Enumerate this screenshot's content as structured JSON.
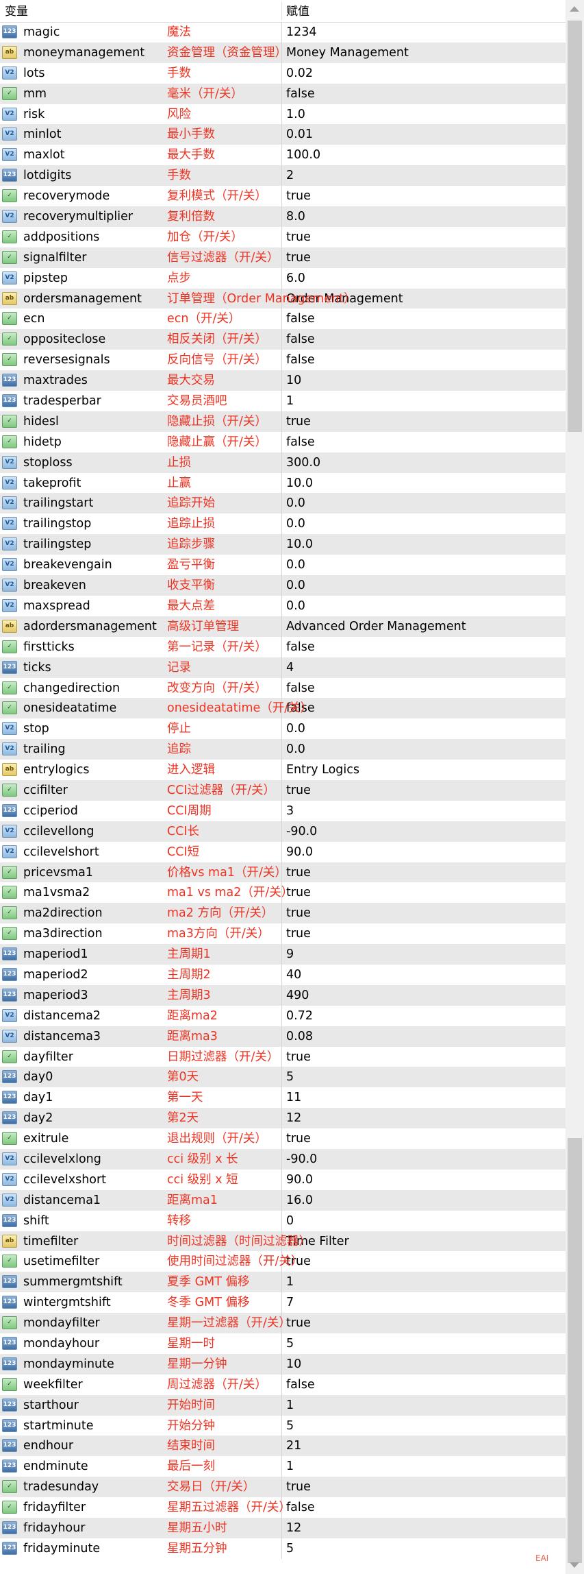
{
  "header": {
    "col_var": "变量",
    "col_val": "赋值"
  },
  "watermark": "EAI",
  "rows": [
    {
      "type": "int",
      "name": "magic",
      "zh": "魔法",
      "value": "1234"
    },
    {
      "type": "str",
      "name": "moneymanagement",
      "zh": "资金管理（资金管理）",
      "value": "Money Management"
    },
    {
      "type": "dbl",
      "name": "lots",
      "zh": "手数",
      "value": "0.02"
    },
    {
      "type": "bool",
      "name": "mm",
      "zh": "毫米（开/关）",
      "value": "false"
    },
    {
      "type": "dbl",
      "name": "risk",
      "zh": "风险",
      "value": "1.0"
    },
    {
      "type": "dbl",
      "name": "minlot",
      "zh": "最小手数",
      "value": "0.01"
    },
    {
      "type": "dbl",
      "name": "maxlot",
      "zh": "最大手数",
      "value": "100.0"
    },
    {
      "type": "int",
      "name": "lotdigits",
      "zh": "手数",
      "value": "2"
    },
    {
      "type": "bool",
      "name": "recoverymode",
      "zh": "复利模式（开/关）",
      "value": "true"
    },
    {
      "type": "dbl",
      "name": "recoverymultiplier",
      "zh": "复利倍数",
      "value": "8.0"
    },
    {
      "type": "bool",
      "name": "addpositions",
      "zh": "加仓（开/关）",
      "value": "true"
    },
    {
      "type": "bool",
      "name": "signalfilter",
      "zh": "信号过滤器（开/关）",
      "value": "true"
    },
    {
      "type": "dbl",
      "name": "pipstep",
      "zh": "点步",
      "value": "6.0"
    },
    {
      "type": "str",
      "name": "ordersmanagement",
      "zh": "订单管理（Order Management）",
      "value": "Order Management"
    },
    {
      "type": "bool",
      "name": "ecn",
      "zh": "ecn（开/关）",
      "value": "false"
    },
    {
      "type": "bool",
      "name": "oppositeclose",
      "zh": "相反关闭（开/关）",
      "value": "false"
    },
    {
      "type": "bool",
      "name": "reversesignals",
      "zh": "反向信号（开/关）",
      "value": "false"
    },
    {
      "type": "int",
      "name": "maxtrades",
      "zh": "最大交易",
      "value": "10"
    },
    {
      "type": "int",
      "name": "tradesperbar",
      "zh": "交易员酒吧",
      "value": "1"
    },
    {
      "type": "bool",
      "name": "hidesl",
      "zh": "隐藏止损（开/关）",
      "value": "true"
    },
    {
      "type": "bool",
      "name": "hidetp",
      "zh": "隐藏止赢（开/关）",
      "value": "false"
    },
    {
      "type": "dbl",
      "name": "stoploss",
      "zh": "止损",
      "value": "300.0"
    },
    {
      "type": "dbl",
      "name": "takeprofit",
      "zh": "止赢",
      "value": "10.0"
    },
    {
      "type": "dbl",
      "name": "trailingstart",
      "zh": "追踪开始",
      "value": "0.0"
    },
    {
      "type": "dbl",
      "name": "trailingstop",
      "zh": "追踪止损",
      "value": "0.0"
    },
    {
      "type": "dbl",
      "name": "trailingstep",
      "zh": "追踪步骤",
      "value": "10.0"
    },
    {
      "type": "dbl",
      "name": "breakevengain",
      "zh": "盈亏平衡",
      "value": "0.0"
    },
    {
      "type": "dbl",
      "name": "breakeven",
      "zh": "收支平衡",
      "value": "0.0"
    },
    {
      "type": "dbl",
      "name": "maxspread",
      "zh": "最大点差",
      "value": "0.0"
    },
    {
      "type": "str",
      "name": "adordersmanagement",
      "zh": "高级订单管理",
      "value": "Advanced Order Management"
    },
    {
      "type": "bool",
      "name": "firstticks",
      "zh": "第一记录（开/关）",
      "value": "false"
    },
    {
      "type": "int",
      "name": "ticks",
      "zh": "记录",
      "value": "4"
    },
    {
      "type": "bool",
      "name": "changedirection",
      "zh": "改变方向（开/关）",
      "value": "false"
    },
    {
      "type": "bool",
      "name": "onesideatatime",
      "zh": "onesideatatime（开/关）",
      "value": "false"
    },
    {
      "type": "dbl",
      "name": "stop",
      "zh": "停止",
      "value": "0.0"
    },
    {
      "type": "dbl",
      "name": "trailing",
      "zh": "追踪",
      "value": "0.0"
    },
    {
      "type": "str",
      "name": "entrylogics",
      "zh": "进入逻辑",
      "value": "Entry Logics"
    },
    {
      "type": "bool",
      "name": "ccifilter",
      "zh": "CCI过滤器（开/关）",
      "value": "true"
    },
    {
      "type": "int",
      "name": "cciperiod",
      "zh": "CCI周期",
      "value": "3"
    },
    {
      "type": "dbl",
      "name": "ccilevellong",
      "zh": "CCI长",
      "value": "-90.0"
    },
    {
      "type": "dbl",
      "name": "ccilevelshort",
      "zh": "CCI短",
      "value": "90.0"
    },
    {
      "type": "bool",
      "name": "pricevsma1",
      "zh": "价格vs ma1（开/关）",
      "value": "true"
    },
    {
      "type": "bool",
      "name": "ma1vsma2",
      "zh": "ma1 vs ma2（开/关）",
      "value": "true"
    },
    {
      "type": "bool",
      "name": "ma2direction",
      "zh": "ma2 方向（开/关）",
      "value": "true"
    },
    {
      "type": "bool",
      "name": "ma3direction",
      "zh": "ma3方向（开/关）",
      "value": "true"
    },
    {
      "type": "int",
      "name": "maperiod1",
      "zh": "主周期1",
      "value": "9"
    },
    {
      "type": "int",
      "name": "maperiod2",
      "zh": "主周期2",
      "value": "40"
    },
    {
      "type": "int",
      "name": "maperiod3",
      "zh": "主周期3",
      "value": "490"
    },
    {
      "type": "dbl",
      "name": "distancema2",
      "zh": "距离ma2",
      "value": "0.72"
    },
    {
      "type": "dbl",
      "name": "distancema3",
      "zh": "距离ma3",
      "value": "0.08"
    },
    {
      "type": "bool",
      "name": "dayfilter",
      "zh": "日期过滤器（开/关）",
      "value": "true"
    },
    {
      "type": "int",
      "name": "day0",
      "zh": "第0天",
      "value": "5"
    },
    {
      "type": "int",
      "name": "day1",
      "zh": "第一天",
      "value": "11"
    },
    {
      "type": "int",
      "name": "day2",
      "zh": "第2天",
      "value": "12"
    },
    {
      "type": "bool",
      "name": "exitrule",
      "zh": "退出规则（开/关）",
      "value": "true"
    },
    {
      "type": "dbl",
      "name": "ccilevelxlong",
      "zh": "cci 级别 x 长",
      "value": "-90.0"
    },
    {
      "type": "dbl",
      "name": "ccilevelxshort",
      "zh": "cci 级别 x 短",
      "value": "90.0"
    },
    {
      "type": "dbl",
      "name": "distancema1",
      "zh": "距离ma1",
      "value": "16.0"
    },
    {
      "type": "int",
      "name": "shift",
      "zh": "转移",
      "value": "0"
    },
    {
      "type": "str",
      "name": "timefilter",
      "zh": "时间过滤器（时间过滤器）",
      "value": "Time Filter"
    },
    {
      "type": "bool",
      "name": "usetimefilter",
      "zh": "使用时间过滤器（开/关）",
      "value": "true"
    },
    {
      "type": "int",
      "name": "summergmtshift",
      "zh": "夏季 GMT 偏移",
      "value": "1"
    },
    {
      "type": "int",
      "name": "wintergmtshift",
      "zh": "冬季 GMT 偏移",
      "value": "7"
    },
    {
      "type": "bool",
      "name": "mondayfilter",
      "zh": "星期一过滤器（开/关）",
      "value": "true"
    },
    {
      "type": "int",
      "name": "mondayhour",
      "zh": "星期一时",
      "value": "5"
    },
    {
      "type": "int",
      "name": "mondayminute",
      "zh": "星期一分钟",
      "value": "10"
    },
    {
      "type": "bool",
      "name": "weekfilter",
      "zh": "周过滤器（开/关）",
      "value": "false"
    },
    {
      "type": "int",
      "name": "starthour",
      "zh": "开始时间",
      "value": "1"
    },
    {
      "type": "int",
      "name": "startminute",
      "zh": "开始分钟",
      "value": "5"
    },
    {
      "type": "int",
      "name": "endhour",
      "zh": "结束时间",
      "value": "21"
    },
    {
      "type": "int",
      "name": "endminute",
      "zh": "最后一刻",
      "value": "1"
    },
    {
      "type": "bool",
      "name": "tradesunday",
      "zh": "交易日（开/关）",
      "value": "true"
    },
    {
      "type": "bool",
      "name": "fridayfilter",
      "zh": "星期五过滤器（开/关）",
      "value": "false"
    },
    {
      "type": "int",
      "name": "fridayhour",
      "zh": "星期五小时",
      "value": "12"
    },
    {
      "type": "int",
      "name": "fridayminute",
      "zh": "星期五分钟",
      "value": "5"
    }
  ],
  "icon_glyphs": {
    "int": "123",
    "dbl": "V2",
    "str": "ab",
    "bool": "✓"
  },
  "icon_names": {
    "int": "integer-type-icon",
    "dbl": "double-type-icon",
    "str": "string-type-icon",
    "bool": "boolean-type-icon"
  }
}
